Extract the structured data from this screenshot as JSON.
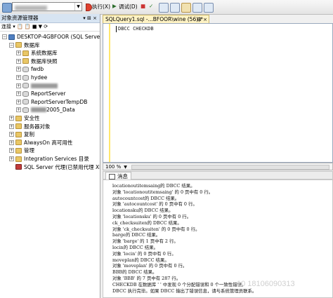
{
  "toolbar": {
    "db_dropdown_arrow": "▼",
    "execute_label": "执行(X)",
    "debug_label": "调试(D)",
    "stop_symbol": "■",
    "check_symbol": "✓"
  },
  "object_explorer": {
    "title": "对象资源管理器",
    "pin": "▾ ⊞ ×",
    "toolbar_label": "连接 ▾ 📋 📋 ■ ▼ ⟳",
    "tree": [
      {
        "label": "DESKTOP-4GBFOOR (SQL Server 11",
        "level": 0,
        "expander": "−",
        "icon": "server"
      },
      {
        "label": "数据库",
        "level": 1,
        "expander": "−",
        "icon": "folder"
      },
      {
        "label": "系统数据库",
        "level": 2,
        "expander": "+",
        "icon": "folder"
      },
      {
        "label": "数据库快照",
        "level": 2,
        "expander": "+",
        "icon": "folder"
      },
      {
        "label": "fwdb",
        "level": 2,
        "expander": "+",
        "icon": "db"
      },
      {
        "label": "hydee",
        "level": 2,
        "expander": "+",
        "icon": "db"
      },
      {
        "label": "",
        "level": 2,
        "expander": "+",
        "icon": "db",
        "blurred": true
      },
      {
        "label": "ReportServer",
        "level": 2,
        "expander": "+",
        "icon": "db"
      },
      {
        "label": "ReportServerTempDB",
        "level": 2,
        "expander": "+",
        "icon": "db"
      },
      {
        "label": "2005_Data",
        "level": 2,
        "expander": "+",
        "icon": "db",
        "blurred_prefix": true
      },
      {
        "label": "安全性",
        "level": 1,
        "expander": "+",
        "icon": "folder"
      },
      {
        "label": "服务器对象",
        "level": 1,
        "expander": "+",
        "icon": "folder"
      },
      {
        "label": "复制",
        "level": 1,
        "expander": "+",
        "icon": "folder"
      },
      {
        "label": "AlwaysOn 高可用性",
        "level": 1,
        "expander": "+",
        "icon": "folder"
      },
      {
        "label": "管理",
        "level": 1,
        "expander": "+",
        "icon": "folder"
      },
      {
        "label": "Integration Services 目录",
        "level": 1,
        "expander": "+",
        "icon": "folder"
      },
      {
        "label": "SQL Server 代理(已禁用代理 XP)",
        "level": 1,
        "expander": "",
        "icon": "agent"
      }
    ]
  },
  "editor": {
    "tab_title": "SQLQuery1.sql -...BFOOR\\wine (56))*",
    "tab_pin": "⊞ ×",
    "sql": "DBCC CHECKDB",
    "zoom": "100 %",
    "zoom_arrow": "▼"
  },
  "results": {
    "tab_label": "消息",
    "messages": [
      "locationoutitemsaing的 DBCC 结果。",
      "对象 'locationoutitemsaing' 的 0 页中有 0 行。",
      "autocountcost的 DBCC 结果。",
      "对象 'autocountcost' 的 0 页中有 0 行。",
      "locationsku的 DBCC 结果。",
      "对象 'locationsku' 的 0 页中有 0 行。",
      "ck_checksuiten的 DBCC 结果。",
      "对象 'ck_checksuiten' 的 0 页中有 0 行。",
      "barge的 DBCC 结果。",
      "对象 'barge' 的 1 页中有 2 行。",
      "locin的 DBCC 结果。",
      "对象 'locin' 的 0 页中有 0 行。",
      "moveplan的 DBCC 结果。",
      "对象 'moveplan' 的 0 页中有 0 行。",
      "BBB的 DBCC 结果。",
      "对象 'BBB' 的 7 页中有 287 行。",
      "CHECKDB 在数据库 '           ' 中发现 0 个分配错误和 0 个一致性错误。",
      "DBCC 执行完毕。如果 DBCC 输出了错误信息，请与系统管理员联系。"
    ],
    "watermark": "10 18106090313"
  }
}
